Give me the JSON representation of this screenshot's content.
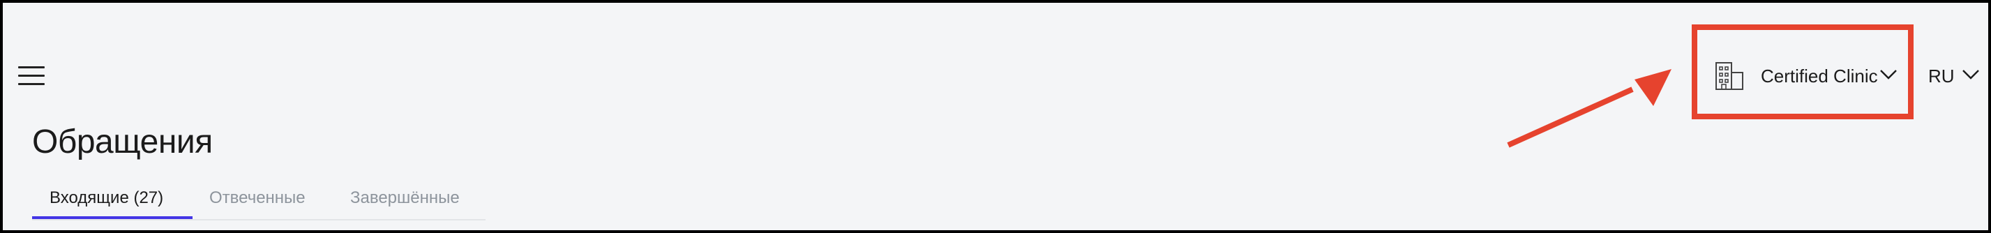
{
  "header": {
    "menu_icon": "hamburger-menu-icon",
    "clinic_selector": {
      "icon": "building-icon",
      "label": "Certified Clinic",
      "chevron_icon": "chevron-down-icon"
    },
    "language_selector": {
      "label": "RU",
      "chevron_icon": "chevron-down-icon"
    }
  },
  "page": {
    "title": "Обращения",
    "tabs": [
      {
        "label": "Входящие (27)",
        "active": true
      },
      {
        "label": "Отвеченные",
        "active": false
      },
      {
        "label": "Завершённые",
        "active": false
      }
    ]
  },
  "annotation": {
    "highlight_color": "#e6432e",
    "accent_color": "#4335e6"
  }
}
